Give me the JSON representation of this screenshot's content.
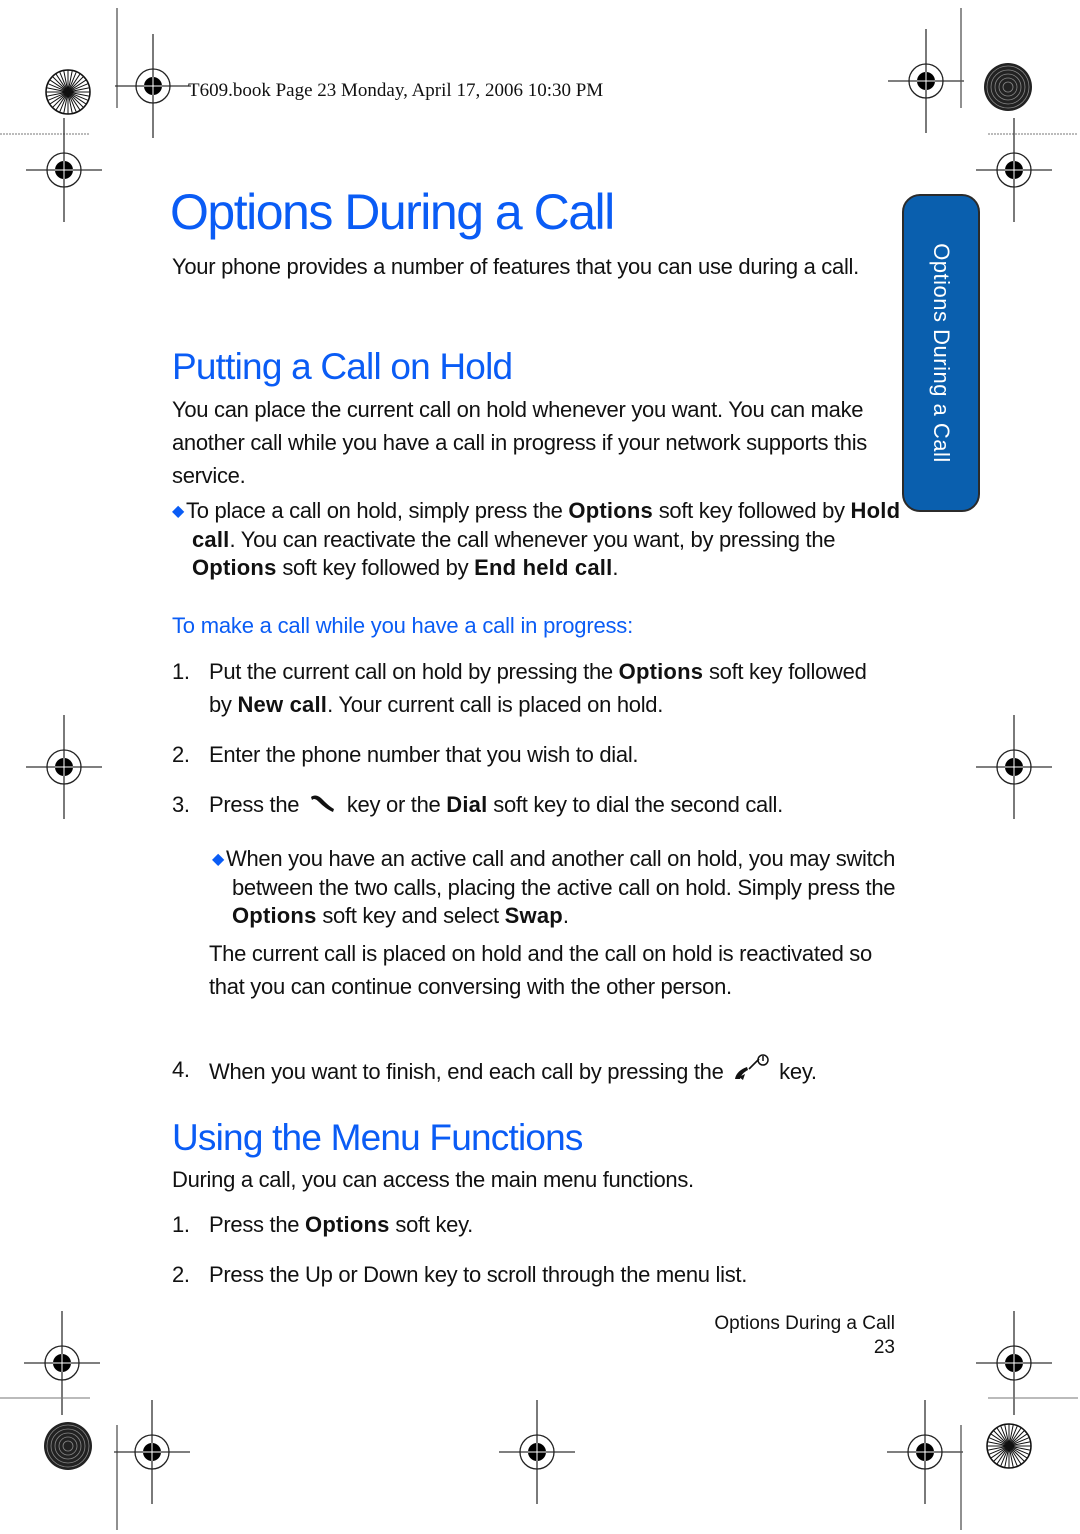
{
  "print_header": "T609.book  Page 23  Monday, April 17, 2006  10:30 PM",
  "side_tab": "Options During a Call",
  "title": "Options During a Call",
  "intro": "Your phone provides a number of features that you can use during a call.",
  "section_hold": {
    "heading": "Putting a Call on Hold",
    "paragraph": "You can place the current call on hold whenever you want. You can make another call while you have a call in progress if your network supports this service.",
    "bullet": {
      "t1": "To place a call on hold, simply press the ",
      "b1": "Options",
      "t2": " soft key followed by ",
      "b2": "Hold call",
      "t3": ". You can reactivate the call whenever you want, by pressing the ",
      "b3": "Options",
      "t4": " soft key followed by ",
      "b4": "End held call",
      "t5": "."
    },
    "procedure_title": "To make a call while you have a call in progress:",
    "steps": [
      {
        "num": "1.",
        "t1": "Put the current call on hold by pressing the ",
        "b1": "Options",
        "t2": " soft key followed by ",
        "b2": "New call",
        "t3": ". Your current call is placed on hold."
      },
      {
        "num": "2.",
        "text": "Enter the phone number that you wish to dial."
      },
      {
        "num": "3.",
        "t1": "Press the ",
        "icon": "send-key-icon",
        "t2": " key or the ",
        "b1": "Dial",
        "t3": " soft key to dial the second call."
      },
      {
        "num": "4.",
        "t1": "When you want to finish, end each call by pressing the ",
        "icon": "end-power-key-icon",
        "t2": " key."
      }
    ],
    "sub_bullet": {
      "t1": "When you have an active call and another call on hold, you may switch between the two calls, placing the active call on hold. Simply press the ",
      "b1": "Options",
      "t2": " soft key and select ",
      "b2": "Swap",
      "t3": "."
    },
    "sub_note": "The current call is placed on hold and the call on hold is reactivated so that you can continue conversing with the other person."
  },
  "section_menu": {
    "heading": "Using the Menu Functions",
    "paragraph": "During a call, you can access the main menu functions.",
    "steps": [
      {
        "num": "1.",
        "t1": "Press the ",
        "b1": "Options",
        "t2": " soft key."
      },
      {
        "num": "2.",
        "text": "Press the Up or Down key to scroll through the menu list."
      }
    ]
  },
  "footer": {
    "section": "Options During a Call",
    "page_number": "23"
  },
  "colors": {
    "heading_blue": "#0a5cf5",
    "tab_blue": "#0a5fae"
  }
}
